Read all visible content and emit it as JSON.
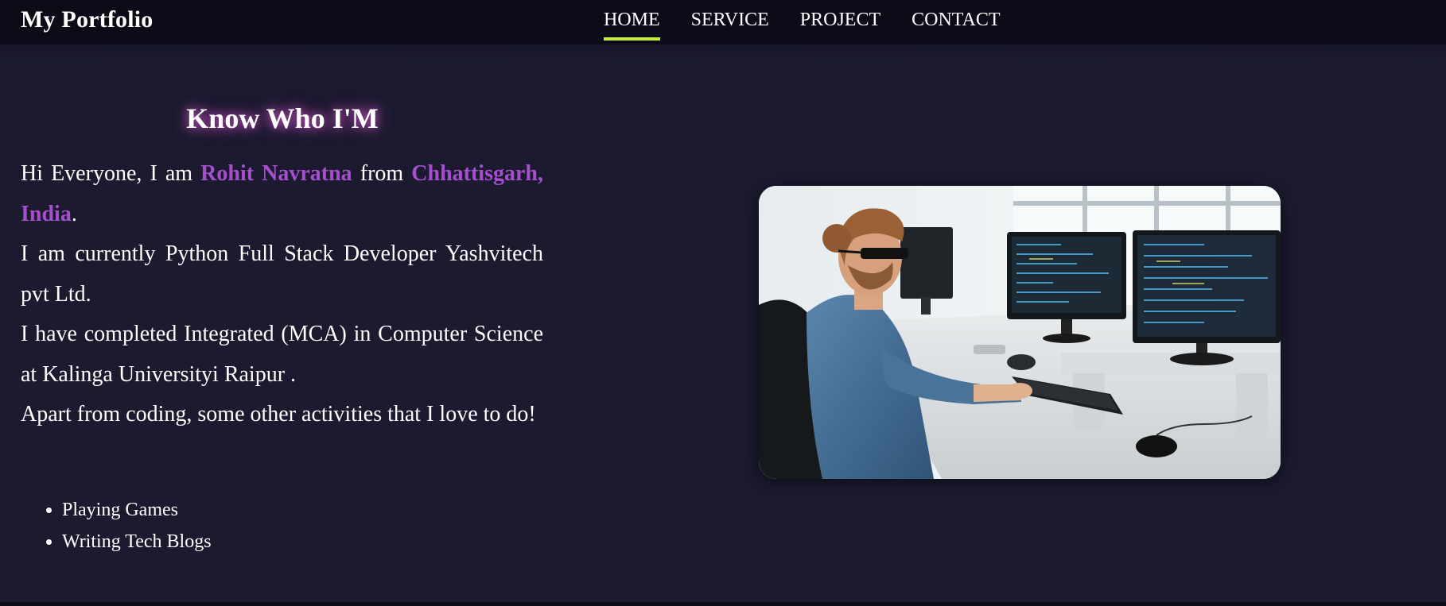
{
  "navbar": {
    "brand": "My Portfolio",
    "links": [
      {
        "label": "HOME",
        "active": true
      },
      {
        "label": "SERVICE",
        "active": false
      },
      {
        "label": "PROJECT",
        "active": false
      },
      {
        "label": "CONTACT",
        "active": false
      }
    ],
    "active_underline_color": "#c6f135"
  },
  "about": {
    "title": "Know Who I'M",
    "intro_prefix": "Hi Everyone, I am ",
    "name": "Rohit Navratna",
    "intro_mid": " from ",
    "location": "Chhattisgarh, India",
    "intro_suffix": ".",
    "job": "I am currently Python Full Stack Developer Yashvitech pvt Ltd.",
    "education": "I have completed Integrated (MCA) in Computer Science at Kalinga Universityi Raipur .",
    "hobbies_intro": "Apart from coding, some other activities that I love to do!",
    "activities": [
      "Playing Games",
      "Writing Tech Blogs"
    ],
    "highlight_color": "#a54fcf"
  },
  "colors": {
    "background": "#1b1a2e",
    "navbar": "#0c0c18"
  }
}
